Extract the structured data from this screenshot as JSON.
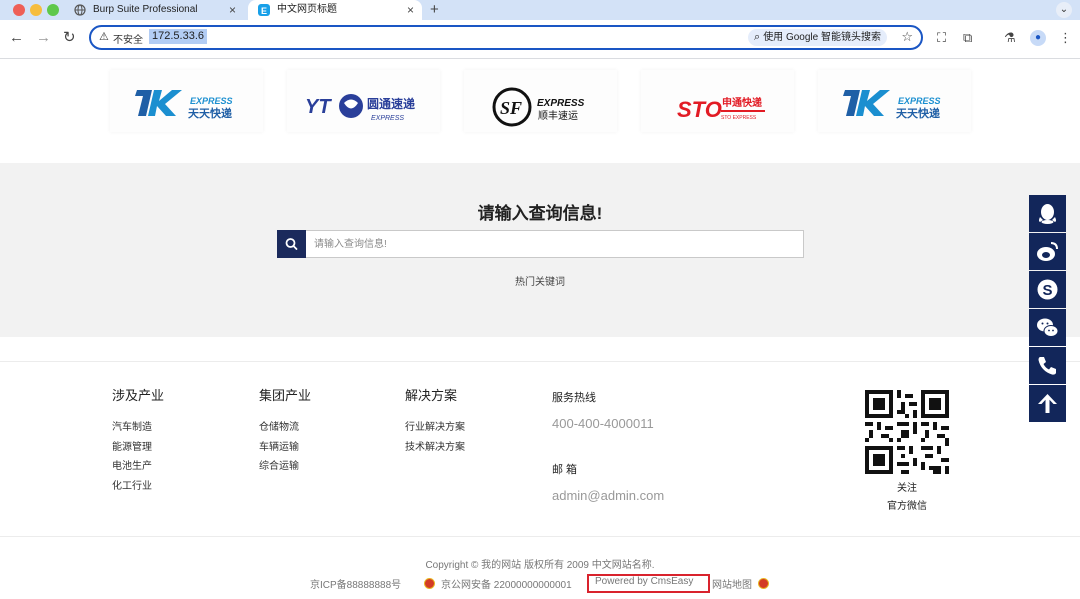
{
  "browser": {
    "tabs": [
      {
        "label": "Burp Suite Professional",
        "active": false
      },
      {
        "label": "中文网页标题",
        "active": true
      }
    ],
    "new_tab": "+",
    "close_glyph": "×",
    "security_label": "不安全",
    "url": "172.5.33.6",
    "lens_label": "使用 Google 智能镜头搜索"
  },
  "logos": [
    {
      "name": "tiantian-express-logo",
      "alt": "天天快递"
    },
    {
      "name": "yuantong-express-logo",
      "alt": "圆通速递"
    },
    {
      "name": "sf-express-logo",
      "alt": "顺丰速运"
    },
    {
      "name": "sto-express-logo",
      "alt": "申通快递"
    },
    {
      "name": "tiantian-express-logo-2",
      "alt": "天天快递"
    }
  ],
  "search": {
    "title": "请输入查询信息!",
    "placeholder": "请输入查询信息!",
    "hot_keywords": "热门关键词"
  },
  "footer_nav": {
    "columns": [
      {
        "title": "涉及产业",
        "items": [
          "汽车制造",
          "能源管理",
          "电池生产",
          "化工行业"
        ]
      },
      {
        "title": "集团产业",
        "items": [
          "仓储物流",
          "车辆运输",
          "综合运输"
        ]
      },
      {
        "title": "解决方案",
        "items": [
          "行业解决方案",
          "技术解决方案"
        ]
      }
    ],
    "contact": {
      "hotline_label": "服务热线",
      "hotline": "400-400-4000011",
      "email_label": "邮 箱",
      "email": "admin@admin.com"
    },
    "qr_caption_line1": "关注",
    "qr_caption_line2": "官方微信"
  },
  "footer": {
    "copyright": "Copyright © 我的网站 版权所有 2009 中文网站名称.",
    "icp": "京ICP备88888888号",
    "police": "京公网安备 22000000000001",
    "powered": "Powered by CmsEasy",
    "sitemap": "网站地图"
  },
  "float_bar": [
    {
      "name": "qq-icon"
    },
    {
      "name": "weibo-icon"
    },
    {
      "name": "skype-icon"
    },
    {
      "name": "wechat-icon"
    },
    {
      "name": "phone-icon"
    },
    {
      "name": "back-to-top-icon"
    }
  ],
  "colors": {
    "brand_navy": "#12265a",
    "search_button": "#1b2a5c",
    "highlight_red": "#d9232d",
    "tabbar": "#d3e2f7",
    "omnibox_border": "#1a56c4"
  }
}
